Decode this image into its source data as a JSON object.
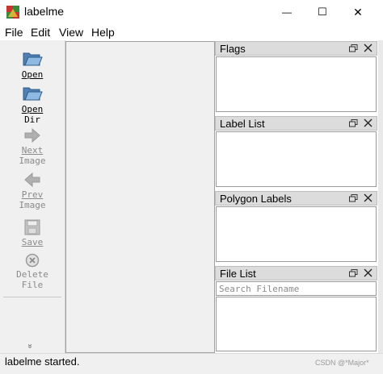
{
  "window": {
    "title": "labelme",
    "minimize_glyph": "—",
    "maximize_glyph": "☐",
    "close_glyph": "✕"
  },
  "menu": {
    "items": [
      {
        "label": "File"
      },
      {
        "label": "Edit"
      },
      {
        "label": "View"
      },
      {
        "label": "Help"
      }
    ]
  },
  "toolbar": {
    "open": {
      "line1": "Open",
      "line2": "",
      "icon": "folder-open-icon"
    },
    "open_dir": {
      "line1": "Open",
      "line2": "Dir",
      "icon": "folder-open-icon"
    },
    "next_image": {
      "line1": "Next",
      "line2": "Image",
      "icon": "arrow-right-icon"
    },
    "prev_image": {
      "line1": "Prev",
      "line2": "Image",
      "icon": "arrow-left-icon"
    },
    "save": {
      "line1": "Save",
      "line2": "",
      "icon": "save-icon"
    },
    "delete_file": {
      "line1": "Delete",
      "line2": "File",
      "icon": "delete-icon"
    },
    "extension_glyph": "»"
  },
  "docks": {
    "flags": {
      "title": "Flags"
    },
    "label_list": {
      "title": "Label List"
    },
    "polygon_labels": {
      "title": "Polygon Labels"
    },
    "file_list": {
      "title": "File List",
      "search_placeholder": "Search Filename"
    }
  },
  "status": {
    "text": "labelme started."
  },
  "watermark": "CSDN @*Major*",
  "colors": {
    "toolbar_bg": "#f0f0f0",
    "dock_header_bg": "#dcdcdc",
    "folder_blue": "#5f8fc0",
    "disabled_gray": "#a8a8a8"
  }
}
